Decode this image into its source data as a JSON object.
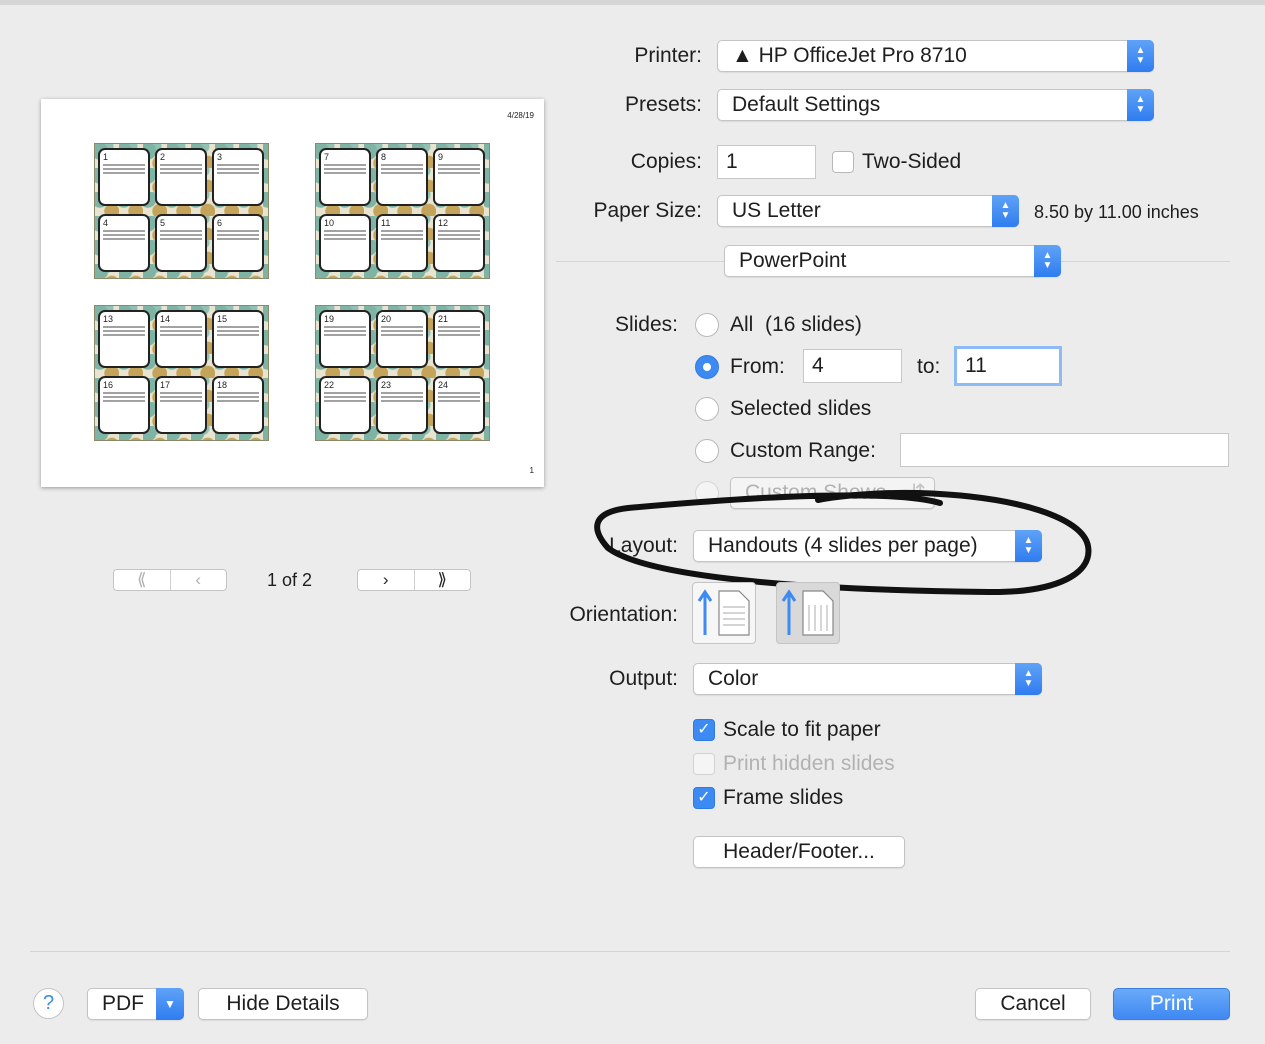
{
  "printer": {
    "label": "Printer:",
    "value": "HP OfficeJet Pro 8710",
    "warning_icon": "warning-triangle-icon"
  },
  "presets": {
    "label": "Presets:",
    "value": "Default Settings"
  },
  "copies": {
    "label": "Copies:",
    "value": "1",
    "two_sided_label": "Two-Sided",
    "two_sided_checked": false
  },
  "paper_size": {
    "label": "Paper Size:",
    "value": "US Letter",
    "dimensions": "8.50 by 11.00 inches"
  },
  "app_panel": {
    "value": "PowerPoint"
  },
  "slides": {
    "label": "Slides:",
    "all_label": "All",
    "all_count": "(16 slides)",
    "from_label": "From:",
    "from_value": "4",
    "to_label": "to:",
    "to_value": "11",
    "selected_label": "Selected slides",
    "custom_range_label": "Custom Range:",
    "custom_range_value": "",
    "custom_shows_label": "Custom Shows",
    "selected_option": "from"
  },
  "layout": {
    "label": "Layout:",
    "value": "Handouts (4 slides per page)"
  },
  "orientation": {
    "label": "Orientation:",
    "selected": "portrait"
  },
  "output": {
    "label": "Output:",
    "value": "Color"
  },
  "options": {
    "scale_to_fit": {
      "label": "Scale to fit paper",
      "checked": true
    },
    "print_hidden": {
      "label": "Print hidden slides",
      "checked": false,
      "enabled": false
    },
    "frame_slides": {
      "label": "Frame slides",
      "checked": true
    }
  },
  "header_footer_label": "Header/Footer...",
  "preview": {
    "date": "4/28/19",
    "page_number": "1",
    "pager_text": "1 of 2",
    "first_icon": "double-chevron-left-icon",
    "prev_icon": "chevron-left-icon",
    "next_icon": "chevron-right-icon",
    "last_icon": "double-chevron-right-icon",
    "slides": [
      {
        "cards": [
          "1",
          "2",
          "3",
          "4",
          "5",
          "6"
        ]
      },
      {
        "cards": [
          "7",
          "8",
          "9",
          "10",
          "11",
          "12"
        ]
      },
      {
        "cards": [
          "13",
          "14",
          "15",
          "16",
          "17",
          "18"
        ]
      },
      {
        "cards": [
          "19",
          "20",
          "21",
          "22",
          "23",
          "24"
        ]
      }
    ]
  },
  "footer": {
    "help_label": "?",
    "pdf_label": "PDF",
    "hide_details_label": "Hide Details",
    "cancel_label": "Cancel",
    "print_label": "Print"
  },
  "colors": {
    "accent": "#3d8bf2",
    "background": "#ececec"
  }
}
